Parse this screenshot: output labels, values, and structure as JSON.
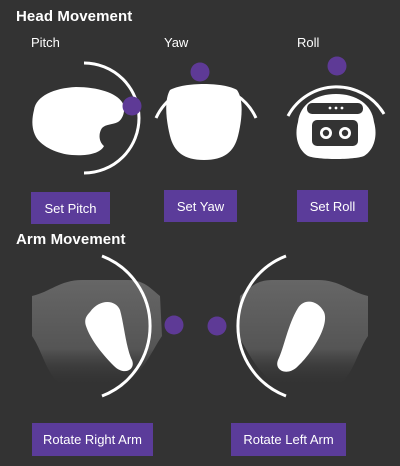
{
  "head": {
    "title": "Head Movement",
    "pitch": {
      "label": "Pitch",
      "button": "Set Pitch"
    },
    "yaw": {
      "label": "Yaw",
      "button": "Set Yaw"
    },
    "roll": {
      "label": "Roll",
      "button": "Set Roll"
    }
  },
  "arm": {
    "title": "Arm Movement",
    "right": {
      "button": "Rotate Right Arm"
    },
    "left": {
      "button": "Rotate Left Arm"
    }
  },
  "colors": {
    "background": "#333333",
    "accent": "#5b3c9a",
    "handle": "#5e3a96",
    "silhouette": "#ffffff"
  }
}
